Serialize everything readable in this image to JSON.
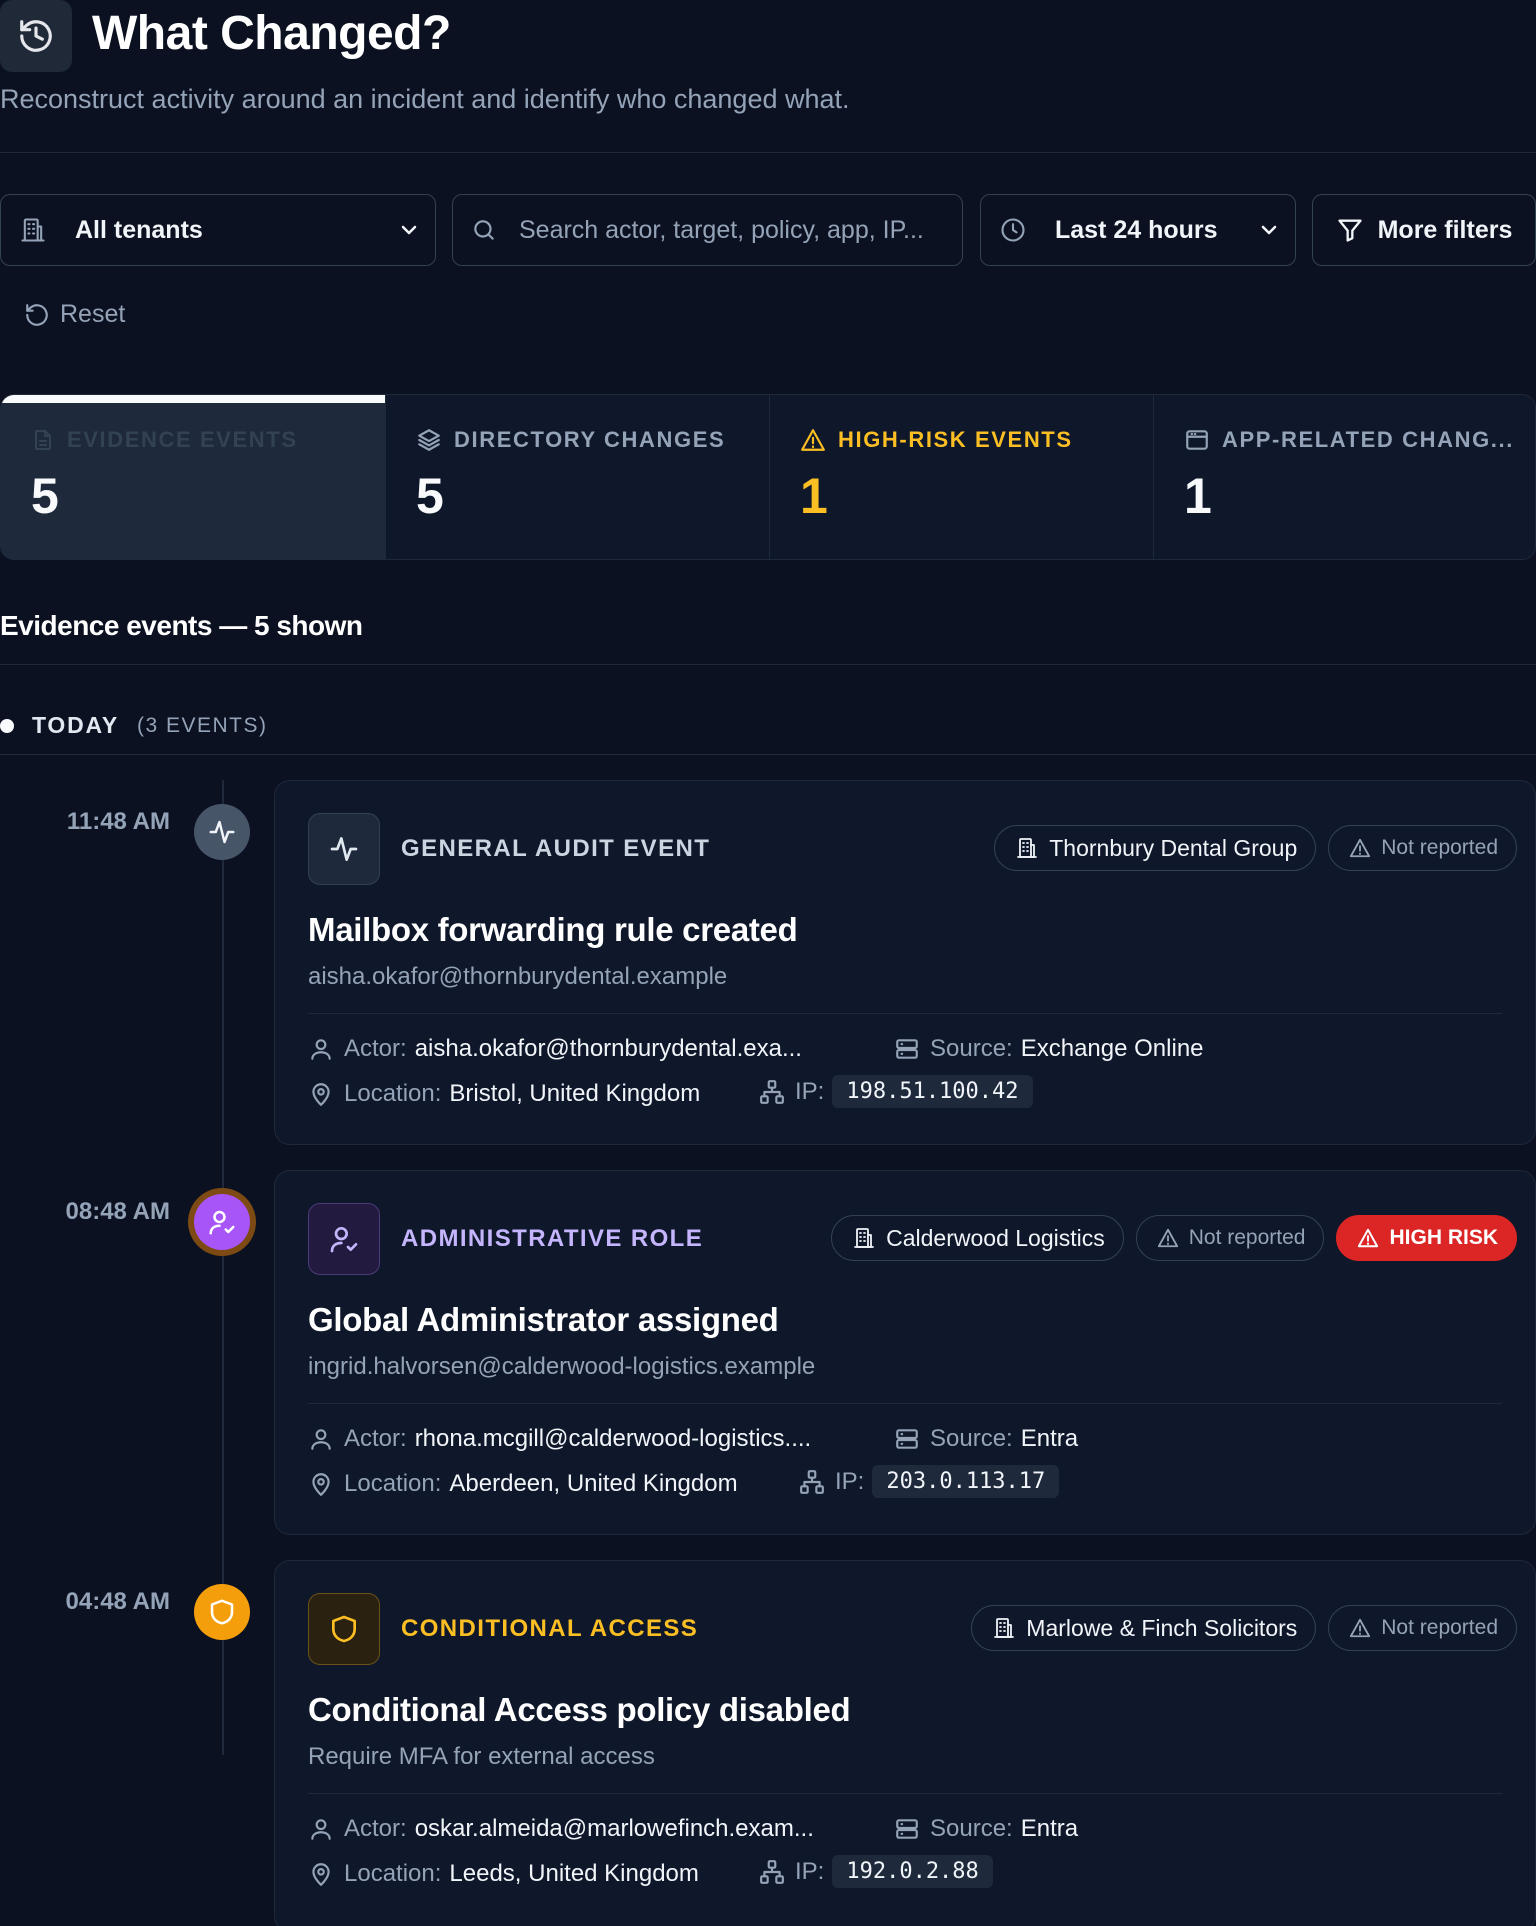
{
  "header": {
    "title": "What Changed?",
    "subtitle": "Reconstruct activity around an incident and identify who changed what."
  },
  "filters": {
    "tenant": "All tenants",
    "search_placeholder": "Search actor, target, policy, app, IP...",
    "time_range": "Last 24 hours",
    "more_filters": "More filters",
    "reset": "Reset"
  },
  "stats": [
    {
      "label": "EVIDENCE EVENTS",
      "value": "5",
      "icon": "document-icon",
      "active": true
    },
    {
      "label": "DIRECTORY CHANGES",
      "value": "5",
      "icon": "layers-icon"
    },
    {
      "label": "HIGH-RISK EVENTS",
      "value": "1",
      "icon": "warning-icon",
      "color": "#fbbf24"
    },
    {
      "label": "APP-RELATED CHANG...",
      "value": "1",
      "icon": "app-window-icon"
    }
  ],
  "section": {
    "title": "Evidence events — 5 shown"
  },
  "group": {
    "label": "TODAY",
    "count": "(3 EVENTS)"
  },
  "events": [
    {
      "time": "11:48 AM",
      "type": "GENERAL AUDIT EVENT",
      "type_color": "#cbd5e1",
      "icon": "activity-icon",
      "tenant": "Thornbury Dental Group",
      "reported": "Not reported",
      "title": "Mailbox forwarding rule created",
      "subtitle": "aisha.okafor@thornburydental.example",
      "actor_label": "Actor:",
      "actor": "aisha.okafor@thornburydental.exa...",
      "source_label": "Source:",
      "source": "Exchange Online",
      "location_label": "Location:",
      "location": "Bristol, United Kingdom",
      "ip_label": "IP:",
      "ip": "198.51.100.42"
    },
    {
      "time": "08:48 AM",
      "type": "ADMINISTRATIVE ROLE",
      "type_color": "#c4b5fd",
      "icon": "user-check-icon",
      "tenant": "Calderwood Logistics",
      "reported": "Not reported",
      "risk": "HIGH RISK",
      "title": "Global Administrator assigned",
      "subtitle": "ingrid.halvorsen@calderwood-logistics.example",
      "actor_label": "Actor:",
      "actor": "rhona.mcgill@calderwood-logistics....",
      "source_label": "Source:",
      "source": "Entra",
      "location_label": "Location:",
      "location": "Aberdeen, United Kingdom",
      "ip_label": "IP:",
      "ip": "203.0.113.17"
    },
    {
      "time": "04:48 AM",
      "type": "CONDITIONAL ACCESS",
      "type_color": "#fbbf24",
      "icon": "shield-icon",
      "tenant": "Marlowe & Finch Solicitors",
      "reported": "Not reported",
      "title": "Conditional Access policy disabled",
      "subtitle": "Require MFA for external access",
      "actor_label": "Actor:",
      "actor": "oskar.almeida@marlowefinch.exam...",
      "source_label": "Source:",
      "source": "Entra",
      "location_label": "Location:",
      "location": "Leeds, United Kingdom",
      "ip_label": "IP:",
      "ip": "192.0.2.88"
    }
  ]
}
